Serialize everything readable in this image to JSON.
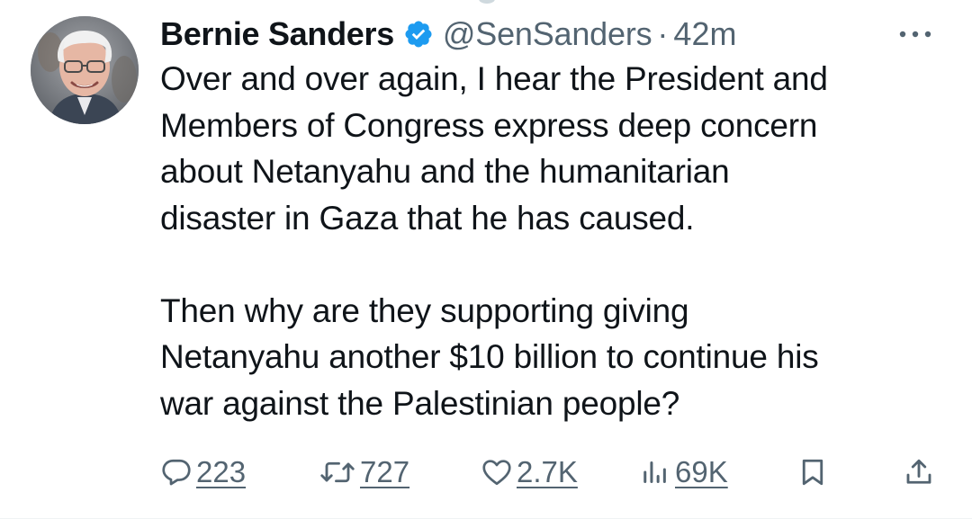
{
  "author": {
    "name": "Bernie Sanders",
    "handle": "@SenSanders",
    "separator": "·",
    "time": "42m",
    "verified": true,
    "verified_color": "#1d9bf0"
  },
  "tweet": {
    "text": "Over and over again, I hear the President and\nMembers of Congress express deep concern\nabout Netanyahu and the humanitarian\ndisaster in Gaza that he has caused.\n\nThen why are they supporting giving\nNetanyahu another $10 billion to continue his\nwar against the Palestinian people?"
  },
  "actions": {
    "replies": "223",
    "retweets": "727",
    "likes": "2.7K",
    "views": "69K"
  },
  "icons": {
    "reply": "reply-icon",
    "retweet": "retweet-icon",
    "like": "heart-icon",
    "views": "views-icon",
    "bookmark": "bookmark-icon",
    "share": "share-icon",
    "more": "more-icon",
    "verified": "verified-badge-icon"
  },
  "colors": {
    "text": "#0f1419",
    "secondary": "#536471",
    "background": "#ffffff"
  }
}
